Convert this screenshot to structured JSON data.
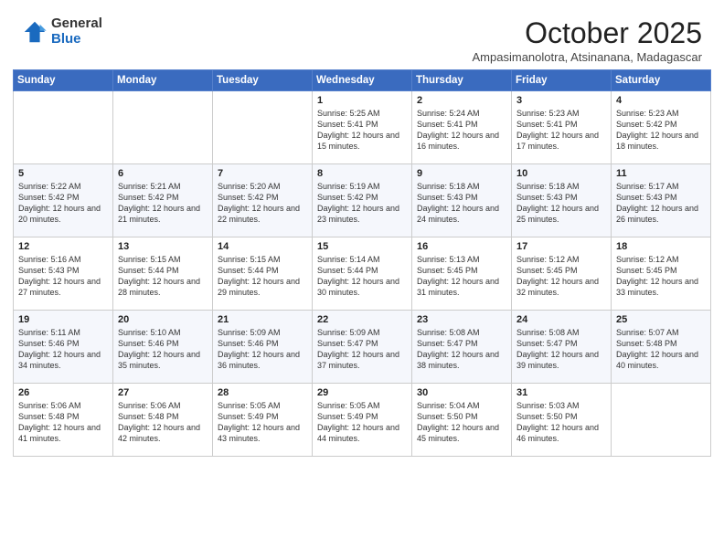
{
  "logo": {
    "general": "General",
    "blue": "Blue"
  },
  "header": {
    "month": "October 2025",
    "location": "Ampasimanolotra, Atsinanana, Madagascar"
  },
  "weekdays": [
    "Sunday",
    "Monday",
    "Tuesday",
    "Wednesday",
    "Thursday",
    "Friday",
    "Saturday"
  ],
  "weeks": [
    [
      {
        "day": "",
        "sunrise": "",
        "sunset": "",
        "daylight": ""
      },
      {
        "day": "",
        "sunrise": "",
        "sunset": "",
        "daylight": ""
      },
      {
        "day": "",
        "sunrise": "",
        "sunset": "",
        "daylight": ""
      },
      {
        "day": "1",
        "sunrise": "Sunrise: 5:25 AM",
        "sunset": "Sunset: 5:41 PM",
        "daylight": "Daylight: 12 hours and 15 minutes."
      },
      {
        "day": "2",
        "sunrise": "Sunrise: 5:24 AM",
        "sunset": "Sunset: 5:41 PM",
        "daylight": "Daylight: 12 hours and 16 minutes."
      },
      {
        "day": "3",
        "sunrise": "Sunrise: 5:23 AM",
        "sunset": "Sunset: 5:41 PM",
        "daylight": "Daylight: 12 hours and 17 minutes."
      },
      {
        "day": "4",
        "sunrise": "Sunrise: 5:23 AM",
        "sunset": "Sunset: 5:42 PM",
        "daylight": "Daylight: 12 hours and 18 minutes."
      }
    ],
    [
      {
        "day": "5",
        "sunrise": "Sunrise: 5:22 AM",
        "sunset": "Sunset: 5:42 PM",
        "daylight": "Daylight: 12 hours and 20 minutes."
      },
      {
        "day": "6",
        "sunrise": "Sunrise: 5:21 AM",
        "sunset": "Sunset: 5:42 PM",
        "daylight": "Daylight: 12 hours and 21 minutes."
      },
      {
        "day": "7",
        "sunrise": "Sunrise: 5:20 AM",
        "sunset": "Sunset: 5:42 PM",
        "daylight": "Daylight: 12 hours and 22 minutes."
      },
      {
        "day": "8",
        "sunrise": "Sunrise: 5:19 AM",
        "sunset": "Sunset: 5:42 PM",
        "daylight": "Daylight: 12 hours and 23 minutes."
      },
      {
        "day": "9",
        "sunrise": "Sunrise: 5:18 AM",
        "sunset": "Sunset: 5:43 PM",
        "daylight": "Daylight: 12 hours and 24 minutes."
      },
      {
        "day": "10",
        "sunrise": "Sunrise: 5:18 AM",
        "sunset": "Sunset: 5:43 PM",
        "daylight": "Daylight: 12 hours and 25 minutes."
      },
      {
        "day": "11",
        "sunrise": "Sunrise: 5:17 AM",
        "sunset": "Sunset: 5:43 PM",
        "daylight": "Daylight: 12 hours and 26 minutes."
      }
    ],
    [
      {
        "day": "12",
        "sunrise": "Sunrise: 5:16 AM",
        "sunset": "Sunset: 5:43 PM",
        "daylight": "Daylight: 12 hours and 27 minutes."
      },
      {
        "day": "13",
        "sunrise": "Sunrise: 5:15 AM",
        "sunset": "Sunset: 5:44 PM",
        "daylight": "Daylight: 12 hours and 28 minutes."
      },
      {
        "day": "14",
        "sunrise": "Sunrise: 5:15 AM",
        "sunset": "Sunset: 5:44 PM",
        "daylight": "Daylight: 12 hours and 29 minutes."
      },
      {
        "day": "15",
        "sunrise": "Sunrise: 5:14 AM",
        "sunset": "Sunset: 5:44 PM",
        "daylight": "Daylight: 12 hours and 30 minutes."
      },
      {
        "day": "16",
        "sunrise": "Sunrise: 5:13 AM",
        "sunset": "Sunset: 5:45 PM",
        "daylight": "Daylight: 12 hours and 31 minutes."
      },
      {
        "day": "17",
        "sunrise": "Sunrise: 5:12 AM",
        "sunset": "Sunset: 5:45 PM",
        "daylight": "Daylight: 12 hours and 32 minutes."
      },
      {
        "day": "18",
        "sunrise": "Sunrise: 5:12 AM",
        "sunset": "Sunset: 5:45 PM",
        "daylight": "Daylight: 12 hours and 33 minutes."
      }
    ],
    [
      {
        "day": "19",
        "sunrise": "Sunrise: 5:11 AM",
        "sunset": "Sunset: 5:46 PM",
        "daylight": "Daylight: 12 hours and 34 minutes."
      },
      {
        "day": "20",
        "sunrise": "Sunrise: 5:10 AM",
        "sunset": "Sunset: 5:46 PM",
        "daylight": "Daylight: 12 hours and 35 minutes."
      },
      {
        "day": "21",
        "sunrise": "Sunrise: 5:09 AM",
        "sunset": "Sunset: 5:46 PM",
        "daylight": "Daylight: 12 hours and 36 minutes."
      },
      {
        "day": "22",
        "sunrise": "Sunrise: 5:09 AM",
        "sunset": "Sunset: 5:47 PM",
        "daylight": "Daylight: 12 hours and 37 minutes."
      },
      {
        "day": "23",
        "sunrise": "Sunrise: 5:08 AM",
        "sunset": "Sunset: 5:47 PM",
        "daylight": "Daylight: 12 hours and 38 minutes."
      },
      {
        "day": "24",
        "sunrise": "Sunrise: 5:08 AM",
        "sunset": "Sunset: 5:47 PM",
        "daylight": "Daylight: 12 hours and 39 minutes."
      },
      {
        "day": "25",
        "sunrise": "Sunrise: 5:07 AM",
        "sunset": "Sunset: 5:48 PM",
        "daylight": "Daylight: 12 hours and 40 minutes."
      }
    ],
    [
      {
        "day": "26",
        "sunrise": "Sunrise: 5:06 AM",
        "sunset": "Sunset: 5:48 PM",
        "daylight": "Daylight: 12 hours and 41 minutes."
      },
      {
        "day": "27",
        "sunrise": "Sunrise: 5:06 AM",
        "sunset": "Sunset: 5:48 PM",
        "daylight": "Daylight: 12 hours and 42 minutes."
      },
      {
        "day": "28",
        "sunrise": "Sunrise: 5:05 AM",
        "sunset": "Sunset: 5:49 PM",
        "daylight": "Daylight: 12 hours and 43 minutes."
      },
      {
        "day": "29",
        "sunrise": "Sunrise: 5:05 AM",
        "sunset": "Sunset: 5:49 PM",
        "daylight": "Daylight: 12 hours and 44 minutes."
      },
      {
        "day": "30",
        "sunrise": "Sunrise: 5:04 AM",
        "sunset": "Sunset: 5:50 PM",
        "daylight": "Daylight: 12 hours and 45 minutes."
      },
      {
        "day": "31",
        "sunrise": "Sunrise: 5:03 AM",
        "sunset": "Sunset: 5:50 PM",
        "daylight": "Daylight: 12 hours and 46 minutes."
      },
      {
        "day": "",
        "sunrise": "",
        "sunset": "",
        "daylight": ""
      }
    ]
  ]
}
